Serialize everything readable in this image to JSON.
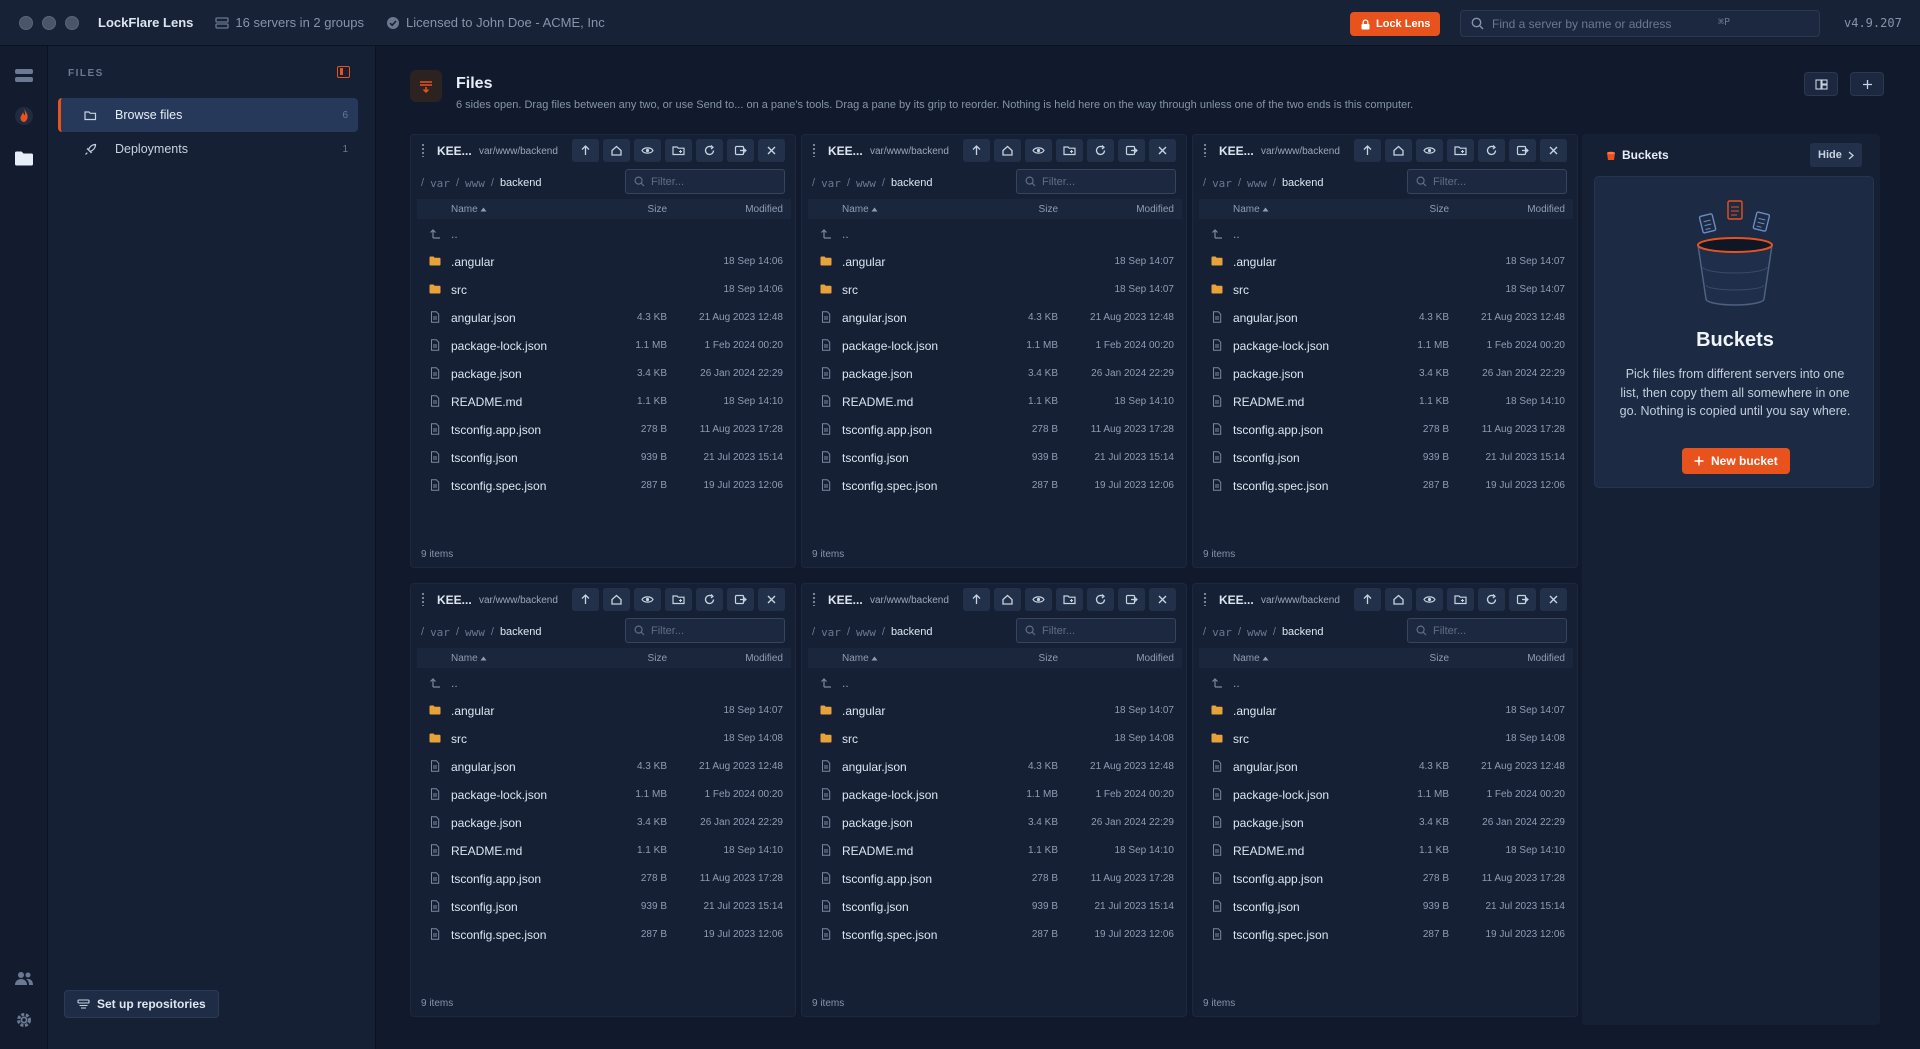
{
  "app": {
    "name": "LockFlare Lens",
    "servers_summary": "16 servers in 2 groups",
    "license": "Licensed to John Doe - ACME, Inc",
    "lock_label": "Lock Lens",
    "search_placeholder": "Find a server by name or address",
    "search_shortcut": "⌘P",
    "version": "v4.9.207",
    "accent": "#e8531d"
  },
  "sidebar": {
    "heading": "FILES",
    "items": [
      {
        "label": "Browse files",
        "count": "6",
        "icon": "folder-icon"
      },
      {
        "label": "Deployments",
        "count": "1",
        "icon": "rocket-icon"
      }
    ],
    "setup_label": "Set up repositories"
  },
  "main": {
    "title": "Files",
    "subtitle": "6 sides open. Drag files between any two, or use Send to... on a pane's tools. Drag a pane by its grip to reorder. Nothing is held here on the way through unless one of the two ends is this computer."
  },
  "pane": {
    "server": "KEE...",
    "path": "var/www/backend",
    "crumbs": [
      "/",
      "var",
      "/",
      "www",
      "/",
      "backend"
    ],
    "filter_placeholder": "Filter...",
    "columns": {
      "name": "Name",
      "size": "Size",
      "modified": "Modified"
    },
    "tools": [
      "arrow-up-icon",
      "home-icon",
      "eye-icon",
      "new-folder-icon",
      "refresh-icon",
      "send-to-icon",
      "close-icon"
    ]
  },
  "panes": [
    {
      "id": "p1",
      "item_count": "9 items",
      "rows": [
        {
          "type": "up",
          "name": "..",
          "size": "",
          "modified": ""
        },
        {
          "type": "folder",
          "name": ".angular",
          "size": "",
          "modified": "18 Sep 14:06"
        },
        {
          "type": "folder",
          "name": "src",
          "size": "",
          "modified": "18 Sep 14:06"
        },
        {
          "type": "file",
          "name": "angular.json",
          "size": "4.3 KB",
          "modified": "21 Aug 2023 12:48"
        },
        {
          "type": "file",
          "name": "package-lock.json",
          "size": "1.1 MB",
          "modified": "1 Feb 2024 00:20"
        },
        {
          "type": "file",
          "name": "package.json",
          "size": "3.4 KB",
          "modified": "26 Jan 2024 22:29"
        },
        {
          "type": "file",
          "name": "README.md",
          "size": "1.1 KB",
          "modified": "18 Sep 14:10"
        },
        {
          "type": "file",
          "name": "tsconfig.app.json",
          "size": "278 B",
          "modified": "11 Aug 2023 17:28"
        },
        {
          "type": "file",
          "name": "tsconfig.json",
          "size": "939 B",
          "modified": "21 Jul 2023 15:14"
        },
        {
          "type": "file",
          "name": "tsconfig.spec.json",
          "size": "287 B",
          "modified": "19 Jul 2023 12:06"
        }
      ]
    },
    {
      "id": "p2",
      "item_count": "9 items",
      "rows": [
        {
          "type": "up",
          "name": "..",
          "size": "",
          "modified": ""
        },
        {
          "type": "folder",
          "name": ".angular",
          "size": "",
          "modified": "18 Sep 14:07"
        },
        {
          "type": "folder",
          "name": "src",
          "size": "",
          "modified": "18 Sep 14:07"
        },
        {
          "type": "file",
          "name": "angular.json",
          "size": "4.3 KB",
          "modified": "21 Aug 2023 12:48"
        },
        {
          "type": "file",
          "name": "package-lock.json",
          "size": "1.1 MB",
          "modified": "1 Feb 2024 00:20"
        },
        {
          "type": "file",
          "name": "package.json",
          "size": "3.4 KB",
          "modified": "26 Jan 2024 22:29"
        },
        {
          "type": "file",
          "name": "README.md",
          "size": "1.1 KB",
          "modified": "18 Sep 14:10"
        },
        {
          "type": "file",
          "name": "tsconfig.app.json",
          "size": "278 B",
          "modified": "11 Aug 2023 17:28"
        },
        {
          "type": "file",
          "name": "tsconfig.json",
          "size": "939 B",
          "modified": "21 Jul 2023 15:14"
        },
        {
          "type": "file",
          "name": "tsconfig.spec.json",
          "size": "287 B",
          "modified": "19 Jul 2023 12:06"
        }
      ]
    },
    {
      "id": "p3",
      "item_count": "9 items",
      "rows": [
        {
          "type": "up",
          "name": "..",
          "size": "",
          "modified": ""
        },
        {
          "type": "folder",
          "name": ".angular",
          "size": "",
          "modified": "18 Sep 14:07"
        },
        {
          "type": "folder",
          "name": "src",
          "size": "",
          "modified": "18 Sep 14:07"
        },
        {
          "type": "file",
          "name": "angular.json",
          "size": "4.3 KB",
          "modified": "21 Aug 2023 12:48"
        },
        {
          "type": "file",
          "name": "package-lock.json",
          "size": "1.1 MB",
          "modified": "1 Feb 2024 00:20"
        },
        {
          "type": "file",
          "name": "package.json",
          "size": "3.4 KB",
          "modified": "26 Jan 2024 22:29"
        },
        {
          "type": "file",
          "name": "README.md",
          "size": "1.1 KB",
          "modified": "18 Sep 14:10"
        },
        {
          "type": "file",
          "name": "tsconfig.app.json",
          "size": "278 B",
          "modified": "11 Aug 2023 17:28"
        },
        {
          "type": "file",
          "name": "tsconfig.json",
          "size": "939 B",
          "modified": "21 Jul 2023 15:14"
        },
        {
          "type": "file",
          "name": "tsconfig.spec.json",
          "size": "287 B",
          "modified": "19 Jul 2023 12:06"
        }
      ]
    },
    {
      "id": "p4",
      "item_count": "9 items",
      "rows": [
        {
          "type": "up",
          "name": "..",
          "size": "",
          "modified": ""
        },
        {
          "type": "folder",
          "name": ".angular",
          "size": "",
          "modified": "18 Sep 14:07"
        },
        {
          "type": "folder",
          "name": "src",
          "size": "",
          "modified": "18 Sep 14:08"
        },
        {
          "type": "file",
          "name": "angular.json",
          "size": "4.3 KB",
          "modified": "21 Aug 2023 12:48"
        },
        {
          "type": "file",
          "name": "package-lock.json",
          "size": "1.1 MB",
          "modified": "1 Feb 2024 00:20"
        },
        {
          "type": "file",
          "name": "package.json",
          "size": "3.4 KB",
          "modified": "26 Jan 2024 22:29"
        },
        {
          "type": "file",
          "name": "README.md",
          "size": "1.1 KB",
          "modified": "18 Sep 14:10"
        },
        {
          "type": "file",
          "name": "tsconfig.app.json",
          "size": "278 B",
          "modified": "11 Aug 2023 17:28"
        },
        {
          "type": "file",
          "name": "tsconfig.json",
          "size": "939 B",
          "modified": "21 Jul 2023 15:14"
        },
        {
          "type": "file",
          "name": "tsconfig.spec.json",
          "size": "287 B",
          "modified": "19 Jul 2023 12:06"
        }
      ]
    },
    {
      "id": "p5",
      "item_count": "9 items",
      "rows": [
        {
          "type": "up",
          "name": "..",
          "size": "",
          "modified": ""
        },
        {
          "type": "folder",
          "name": ".angular",
          "size": "",
          "modified": "18 Sep 14:07"
        },
        {
          "type": "folder",
          "name": "src",
          "size": "",
          "modified": "18 Sep 14:08"
        },
        {
          "type": "file",
          "name": "angular.json",
          "size": "4.3 KB",
          "modified": "21 Aug 2023 12:48"
        },
        {
          "type": "file",
          "name": "package-lock.json",
          "size": "1.1 MB",
          "modified": "1 Feb 2024 00:20"
        },
        {
          "type": "file",
          "name": "package.json",
          "size": "3.4 KB",
          "modified": "26 Jan 2024 22:29"
        },
        {
          "type": "file",
          "name": "README.md",
          "size": "1.1 KB",
          "modified": "18 Sep 14:10"
        },
        {
          "type": "file",
          "name": "tsconfig.app.json",
          "size": "278 B",
          "modified": "11 Aug 2023 17:28"
        },
        {
          "type": "file",
          "name": "tsconfig.json",
          "size": "939 B",
          "modified": "21 Jul 2023 15:14"
        },
        {
          "type": "file",
          "name": "tsconfig.spec.json",
          "size": "287 B",
          "modified": "19 Jul 2023 12:06"
        }
      ]
    },
    {
      "id": "p6",
      "item_count": "9 items",
      "rows": [
        {
          "type": "up",
          "name": "..",
          "size": "",
          "modified": ""
        },
        {
          "type": "folder",
          "name": ".angular",
          "size": "",
          "modified": "18 Sep 14:07"
        },
        {
          "type": "folder",
          "name": "src",
          "size": "",
          "modified": "18 Sep 14:08"
        },
        {
          "type": "file",
          "name": "angular.json",
          "size": "4.3 KB",
          "modified": "21 Aug 2023 12:48"
        },
        {
          "type": "file",
          "name": "package-lock.json",
          "size": "1.1 MB",
          "modified": "1 Feb 2024 00:20"
        },
        {
          "type": "file",
          "name": "package.json",
          "size": "3.4 KB",
          "modified": "26 Jan 2024 22:29"
        },
        {
          "type": "file",
          "name": "README.md",
          "size": "1.1 KB",
          "modified": "18 Sep 14:10"
        },
        {
          "type": "file",
          "name": "tsconfig.app.json",
          "size": "278 B",
          "modified": "11 Aug 2023 17:28"
        },
        {
          "type": "file",
          "name": "tsconfig.json",
          "size": "939 B",
          "modified": "21 Jul 2023 15:14"
        },
        {
          "type": "file",
          "name": "tsconfig.spec.json",
          "size": "287 B",
          "modified": "19 Jul 2023 12:06"
        }
      ]
    }
  ],
  "buckets": {
    "title": "Buckets",
    "hide_label": "Hide",
    "empty_title": "Buckets",
    "empty_desc": "Pick files from different servers into one list, then copy them all somewhere in one go. Nothing is copied until you say where.",
    "new_label": "New bucket"
  }
}
